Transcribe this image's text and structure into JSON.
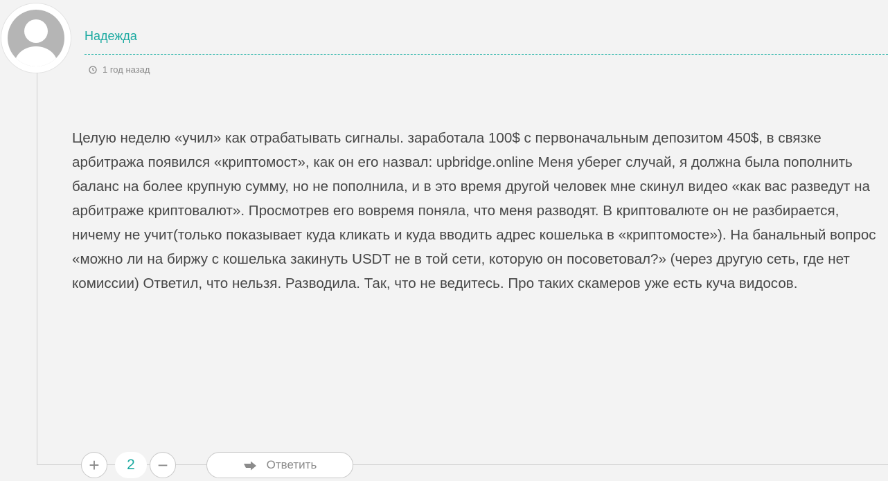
{
  "comment": {
    "author": "Надежда",
    "time_ago": "1 год назад",
    "text": "Целую неделю «учил» как отрабатывать сигналы. заработала 100$ с первоначальным депозитом 450$, в связке арбитража появился «криптомост», как он его назвал: upbridge.online Меня уберег случай, я должна была пополнить баланс на более крупную сумму, но не пополнила, и в это время другой человек мне скинул видео «как вас разведут на арбитраже криптовалют». Просмотрев его вовремя поняла, что меня разводят. В криптовалюте он не разбирается, ничему не учит(только показывает куда кликать и куда вводить адрес кошелька в «криптомосте»). На банальный вопрос «можно ли на биржу с кошелька закинуть USDT не в той сети, которую он посоветовал?» (через другую сеть, где нет комиссии) Ответил, что нельзя. Разводила. Так, что не ведитесь. Про таких скамеров уже есть куча видосов."
  },
  "votes": {
    "plus_label": "+",
    "count": "2",
    "minus_label": "−"
  },
  "actions": {
    "reply_label": "Ответить"
  },
  "icons": {
    "avatar": "default-user-avatar",
    "time": "clock-icon",
    "reply": "reply-arrow-icon"
  },
  "colors": {
    "accent": "#1aa9a0",
    "text": "#474747",
    "muted": "#8b8b8b",
    "background": "#f3f3f3"
  }
}
